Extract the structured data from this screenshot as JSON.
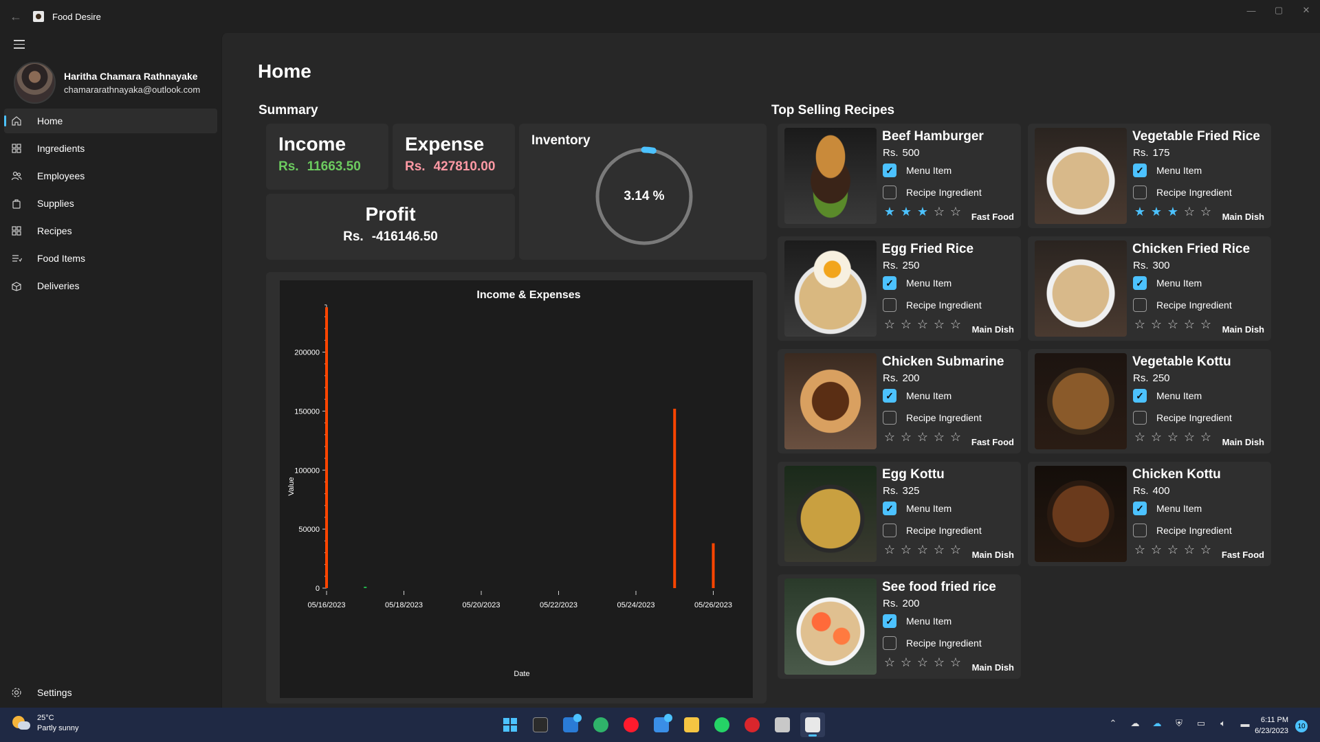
{
  "window": {
    "title": "Food Desire",
    "controls": [
      "—",
      "▢",
      "✕"
    ]
  },
  "user": {
    "name": "Haritha Chamara Rathnayake",
    "email": "chamararathnayaka@outlook.com"
  },
  "nav": {
    "items": [
      {
        "label": "Home",
        "icon": "home-icon",
        "active": true
      },
      {
        "label": "Ingredients",
        "icon": "grid-icon"
      },
      {
        "label": "Employees",
        "icon": "people-icon"
      },
      {
        "label": "Supplies",
        "icon": "bag-icon"
      },
      {
        "label": "Recipes",
        "icon": "grid-icon"
      },
      {
        "label": "Food Items",
        "icon": "list-icon"
      },
      {
        "label": "Deliveries",
        "icon": "box-icon"
      }
    ],
    "settings_label": "Settings"
  },
  "page": {
    "title": "Home"
  },
  "summary": {
    "title": "Summary",
    "income": {
      "label": "Income",
      "currency": "Rs.",
      "value": "11663.50"
    },
    "expense": {
      "label": "Expense",
      "currency": "Rs.",
      "value": "427810.00"
    },
    "profit": {
      "label": "Profit",
      "currency": "Rs.",
      "value": "-416146.50"
    },
    "inventory": {
      "label": "Inventory",
      "percent_text": "3.14 %",
      "percent": 3.14
    }
  },
  "chart_data": {
    "type": "bar",
    "title": "Income & Expenses",
    "xlabel": "Date",
    "ylabel": "Value",
    "x_ticks": [
      "05/16/2023",
      "05/18/2023",
      "05/20/2023",
      "05/22/2023",
      "05/24/2023",
      "05/26/2023"
    ],
    "y_ticks": [
      0,
      50000,
      100000,
      150000,
      200000
    ],
    "ylim": [
      0,
      240000
    ],
    "series": [
      {
        "color": "#ff4500",
        "points": [
          {
            "x": "05/16/2023",
            "y": 238000
          },
          {
            "x": "05/25/2023",
            "y": 152000
          },
          {
            "x": "05/26/2023",
            "y": 38000
          }
        ]
      },
      {
        "color": "#22b14c",
        "points": [
          {
            "x": "05/17/2023",
            "y": 1200
          }
        ]
      }
    ],
    "grid": false
  },
  "top_selling": {
    "title": "Top Selling Recipes",
    "menu_item_label": "Menu Item",
    "recipe_ingredient_label": "Recipe Ingredient",
    "currency": "Rs.",
    "recipes": [
      {
        "name": "Beef Hamburger",
        "price": "500",
        "menu_item": true,
        "recipe_ingredient": false,
        "rating": 3,
        "category": "Fast Food",
        "image": "burger"
      },
      {
        "name": "Vegetable Fried Rice",
        "price": "175",
        "menu_item": true,
        "recipe_ingredient": false,
        "rating": 3,
        "category": "Main Dish",
        "image": "rice"
      },
      {
        "name": "Egg Fried Rice",
        "price": "250",
        "menu_item": true,
        "recipe_ingredient": false,
        "rating": 0,
        "category": "Main Dish",
        "image": "egg-rice"
      },
      {
        "name": "Chicken Fried Rice",
        "price": "300",
        "menu_item": true,
        "recipe_ingredient": false,
        "rating": 0,
        "category": "Main Dish",
        "image": "rice"
      },
      {
        "name": "Chicken Submarine",
        "price": "200",
        "menu_item": true,
        "recipe_ingredient": false,
        "rating": 0,
        "category": "Fast Food",
        "image": "sub"
      },
      {
        "name": "Vegetable Kottu",
        "price": "250",
        "menu_item": true,
        "recipe_ingredient": false,
        "rating": 0,
        "category": "Main Dish",
        "image": "kottu"
      },
      {
        "name": "Egg Kottu",
        "price": "325",
        "menu_item": true,
        "recipe_ingredient": false,
        "rating": 0,
        "category": "Main Dish",
        "image": "egg-kottu"
      },
      {
        "name": "Chicken Kottu",
        "price": "400",
        "menu_item": true,
        "recipe_ingredient": false,
        "rating": 0,
        "category": "Fast Food",
        "image": "kottu-dark"
      },
      {
        "name": "See food fried rice",
        "price": "200",
        "menu_item": true,
        "recipe_ingredient": false,
        "rating": 0,
        "category": "Main Dish",
        "image": "seafood"
      }
    ]
  },
  "taskbar": {
    "weather": {
      "temp": "25°C",
      "condition": "Partly sunny"
    },
    "time": "6:11 PM",
    "date": "6/23/2023",
    "notifications": "10"
  }
}
